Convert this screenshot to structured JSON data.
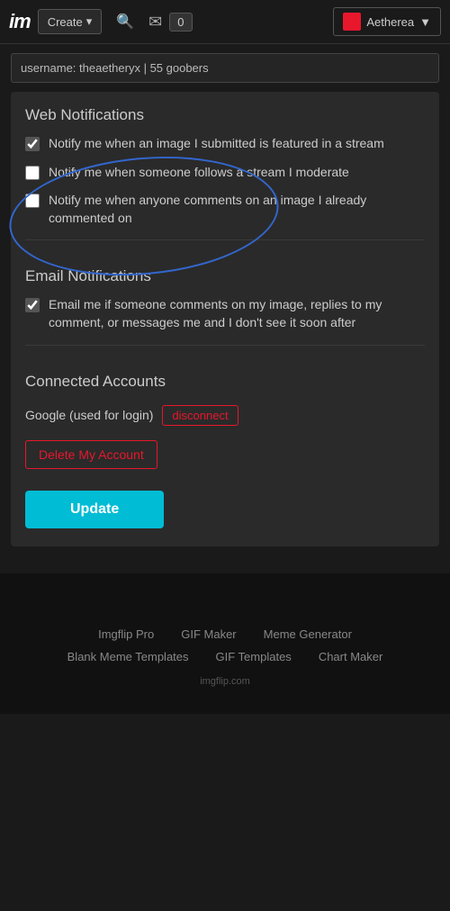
{
  "header": {
    "logo_i": "i",
    "logo_m": "m",
    "create_label": "Create",
    "notification_count": "0",
    "username": "Aetherea",
    "dropdown_arrow": "▼"
  },
  "username_bar": {
    "text": "username: theaetheryx | 55 goobers"
  },
  "web_notifications": {
    "title": "Web Notifications",
    "items": [
      {
        "id": "notif1",
        "label": "Notify me when an image I submitted is featured in a stream",
        "checked": true
      },
      {
        "id": "notif2",
        "label": "Notify me when someone follows a stream I moderate",
        "checked": false
      },
      {
        "id": "notif3",
        "label": "Notify me when anyone comments on an image I already commented on",
        "checked": false
      }
    ]
  },
  "email_notifications": {
    "title": "Email Notifications",
    "items": [
      {
        "id": "email1",
        "label": "Email me if someone comments on my image, replies to my comment, or messages me and I don't see it soon after",
        "checked": true
      }
    ]
  },
  "connected_accounts": {
    "title": "Connected Accounts",
    "google_label": "Google (used for login)",
    "disconnect_label": "disconnect"
  },
  "delete_account": {
    "label": "Delete My Account"
  },
  "update_button": {
    "label": "Update"
  },
  "footer": {
    "row1": [
      {
        "label": "Imgflip Pro"
      },
      {
        "label": "GIF Maker"
      },
      {
        "label": "Meme Generator"
      }
    ],
    "row2": [
      {
        "label": "Blank Meme Templates"
      },
      {
        "label": "GIF Templates"
      },
      {
        "label": "Chart Maker"
      }
    ],
    "domain": "imgflip.com"
  }
}
